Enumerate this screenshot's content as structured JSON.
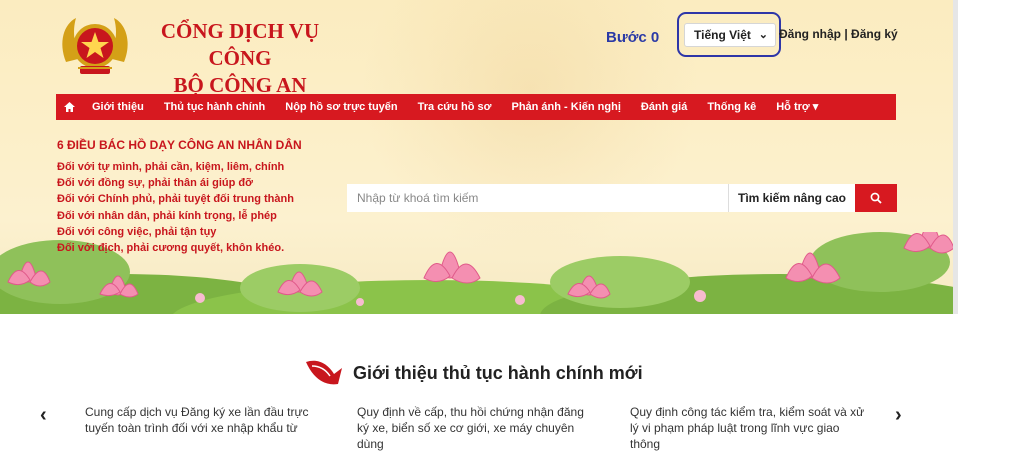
{
  "header": {
    "title_line1": "CỔNG DỊCH VỤ CÔNG",
    "title_line2": "BỘ CÔNG AN",
    "step_label": "Bước 0",
    "language": "Tiếng Việt",
    "login": "Đăng nhập",
    "separator": " | ",
    "register": "Đăng ký"
  },
  "nav": {
    "items": [
      "Giới thiệu",
      "Thủ tục hành chính",
      "Nộp hồ sơ trực tuyến",
      "Tra cứu hồ sơ",
      "Phản ánh - Kiến nghị",
      "Đánh giá",
      "Thống kê",
      "Hỗ trợ ▾"
    ]
  },
  "rules": {
    "title": "6 ĐIỀU BÁC HỒ DẠY CÔNG AN NHÂN DÂN",
    "items": [
      "Đối với tự mình, phải cần, kiệm, liêm, chính",
      "Đối với đồng sự, phải thân ái giúp đỡ",
      "Đối với Chính phủ, phải tuyệt đối trung thành",
      "Đối với nhân dân, phải kính trọng, lễ phép",
      "Đối với công việc, phải tận tụy",
      "Đối với địch, phải cương quyết, khôn khéo."
    ]
  },
  "search": {
    "placeholder": "Nhập từ khoá tìm kiếm",
    "advanced_label": "Tìm kiếm nâng cao"
  },
  "section": {
    "title": "Giới thiệu thủ tục hành chính mới",
    "cards": [
      "Cung cấp dịch vụ Đăng ký xe lần đầu trực tuyến toàn trình đối với xe nhập khẩu từ",
      "Quy định về cấp, thu hồi chứng nhận đăng ký xe, biển số xe cơ giới, xe máy chuyên dùng",
      "Quy định công tác kiểm tra, kiểm soát và xử lý vi phạm pháp luật trong lĩnh vực giao thông"
    ],
    "prev": "‹",
    "next": "›"
  },
  "colors": {
    "primary_red": "#d71920",
    "title_red": "#c8161d",
    "step_blue": "#2b3aa6",
    "hero_bg": "#fcefc8"
  }
}
